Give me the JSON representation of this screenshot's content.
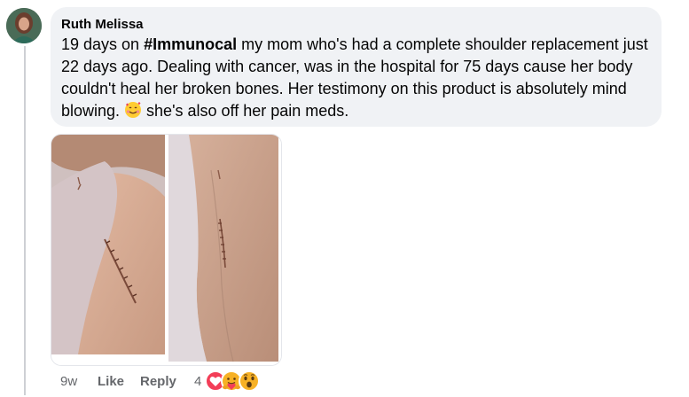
{
  "comment": {
    "author": "Ruth Melissa",
    "text_before": "19 days on ",
    "hashtag": "#Immunocal",
    "text_after": " my mom who's had a complete shoulder replacement just 22 days ago. Dealing with cancer, was in the hospital for 75 days cause her body couldn't heal her broken bones. Her testimony on this product is absolutely mind blowing. ",
    "emoji": "smiling-face-with-hearts",
    "text_end": " she's also off her pain meds."
  },
  "attachment": {
    "type": "photo-collage",
    "description": "two photos of shoulder surgery scar"
  },
  "actions": {
    "time": "9w",
    "like": "Like",
    "reply": "Reply",
    "reaction_count": "4",
    "reaction_icons": [
      "love-icon",
      "care-icon",
      "wow-icon"
    ]
  }
}
